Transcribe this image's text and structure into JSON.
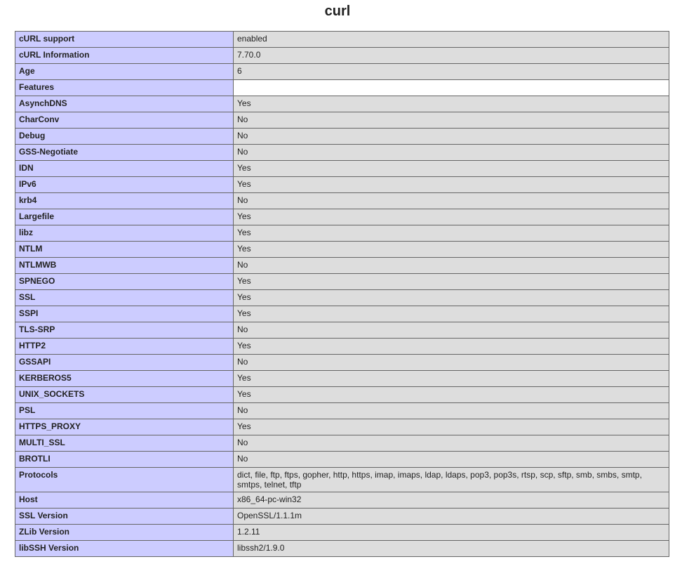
{
  "page": {
    "title": "curl"
  },
  "rows": [
    {
      "key": "cURL support",
      "value": "enabled"
    },
    {
      "key": "cURL Information",
      "value": "7.70.0"
    },
    {
      "key": "Age",
      "value": "6"
    },
    {
      "key": "Features",
      "value": "",
      "header": true
    },
    {
      "key": "AsynchDNS",
      "value": "Yes"
    },
    {
      "key": "CharConv",
      "value": "No"
    },
    {
      "key": "Debug",
      "value": "No"
    },
    {
      "key": "GSS-Negotiate",
      "value": "No"
    },
    {
      "key": "IDN",
      "value": "Yes"
    },
    {
      "key": "IPv6",
      "value": "Yes"
    },
    {
      "key": "krb4",
      "value": "No"
    },
    {
      "key": "Largefile",
      "value": "Yes"
    },
    {
      "key": "libz",
      "value": "Yes"
    },
    {
      "key": "NTLM",
      "value": "Yes"
    },
    {
      "key": "NTLMWB",
      "value": "No"
    },
    {
      "key": "SPNEGO",
      "value": "Yes"
    },
    {
      "key": "SSL",
      "value": "Yes"
    },
    {
      "key": "SSPI",
      "value": "Yes"
    },
    {
      "key": "TLS-SRP",
      "value": "No"
    },
    {
      "key": "HTTP2",
      "value": "Yes"
    },
    {
      "key": "GSSAPI",
      "value": "No"
    },
    {
      "key": "KERBEROS5",
      "value": "Yes"
    },
    {
      "key": "UNIX_SOCKETS",
      "value": "Yes"
    },
    {
      "key": "PSL",
      "value": "No"
    },
    {
      "key": "HTTPS_PROXY",
      "value": "Yes"
    },
    {
      "key": "MULTI_SSL",
      "value": "No"
    },
    {
      "key": "BROTLI",
      "value": "No"
    },
    {
      "key": "Protocols",
      "value": "dict, file, ftp, ftps, gopher, http, https, imap, imaps, ldap, ldaps, pop3, pop3s, rtsp, scp, sftp, smb, smbs, smtp, smtps, telnet, tftp"
    },
    {
      "key": "Host",
      "value": "x86_64-pc-win32"
    },
    {
      "key": "SSL Version",
      "value": "OpenSSL/1.1.1m"
    },
    {
      "key": "ZLib Version",
      "value": "1.2.11"
    },
    {
      "key": "libSSH Version",
      "value": "libssh2/1.9.0"
    }
  ],
  "colors": {
    "key_bg": "#ccccff",
    "value_bg": "#dddddd",
    "border": "#666666"
  }
}
